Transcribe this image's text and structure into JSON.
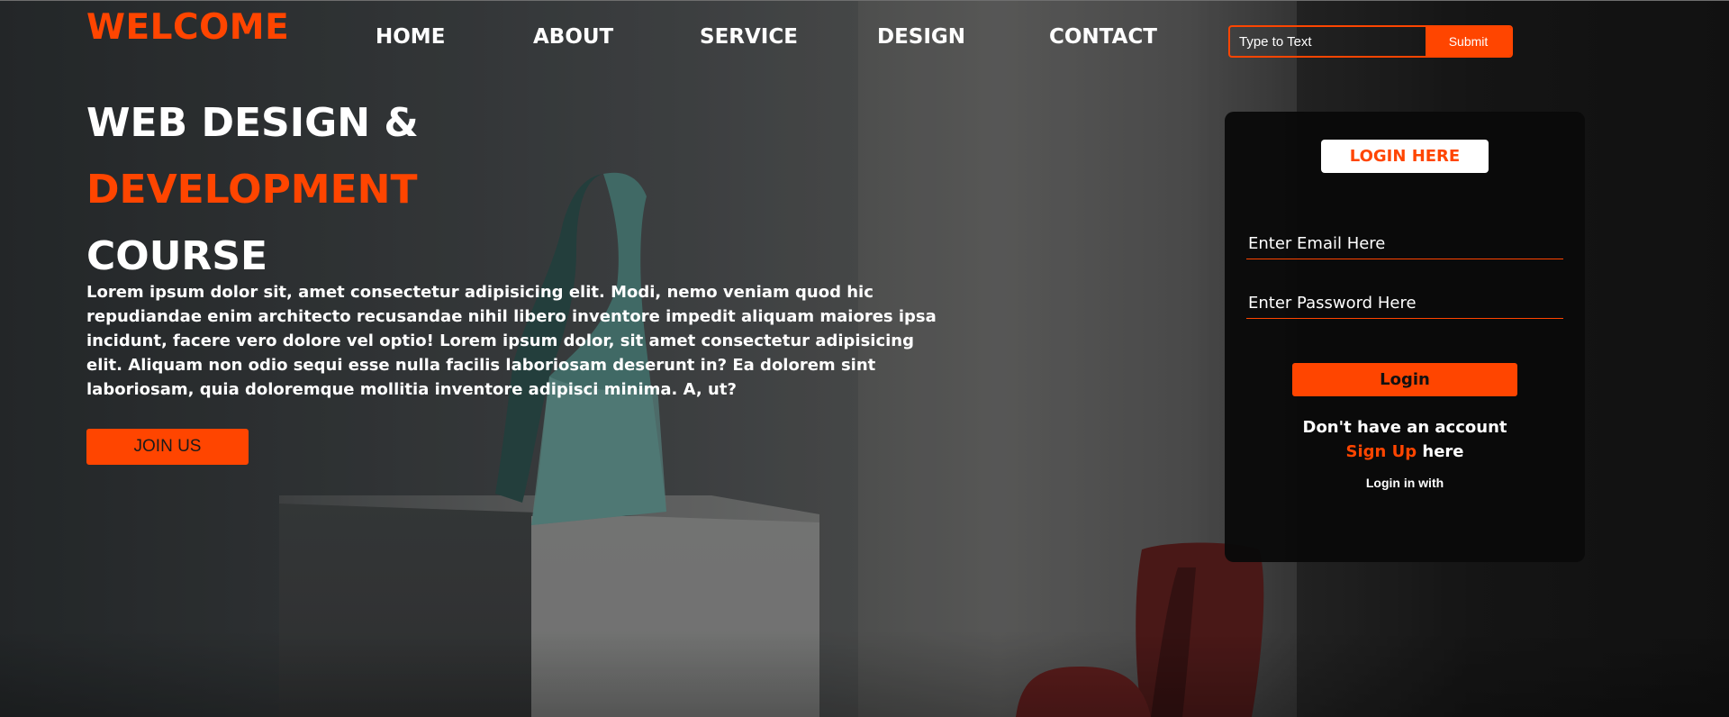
{
  "colors": {
    "accent": "#ff4500",
    "text": "#ffffff",
    "panel_background": "#0a0a0a"
  },
  "header": {
    "logo": "WELCOME",
    "nav": [
      {
        "label": "HOME"
      },
      {
        "label": "ABOUT"
      },
      {
        "label": "SERVICE"
      },
      {
        "label": "DESIGN"
      },
      {
        "label": "CONTACT"
      }
    ],
    "search": {
      "placeholder": "Type to Text",
      "submit_label": "Submit"
    }
  },
  "hero": {
    "title_line1": "WEB DESIGN &",
    "title_line2": "DEVELOPMENT",
    "title_line3": "COURSE",
    "description": "Lorem ipsum dolor sit, amet consectetur adipisicing elit. Modi, nemo veniam quod hic repudiandae enim architecto recusandae nihil libero inventore impedit aliquam maiores ipsa incidunt, facere vero dolore vel optio! Lorem ipsum dolor, sit amet consectetur adipisicing elit. Aliquam non odio sequi esse nulla facilis laboriosam deserunt in? Ea dolorem sint laboriosam, quia doloremque mollitia inventore adipisci minima. A, ut?",
    "cta_label": "JOIN US"
  },
  "login": {
    "heading": "LOGIN HERE",
    "email_placeholder": "Enter Email Here",
    "password_placeholder": "Enter Password Here",
    "button_label": "Login",
    "account_prompt": "Don't have an account",
    "signup_link": "Sign Up",
    "signup_suffix": "here",
    "social_prompt": "Login in with"
  }
}
